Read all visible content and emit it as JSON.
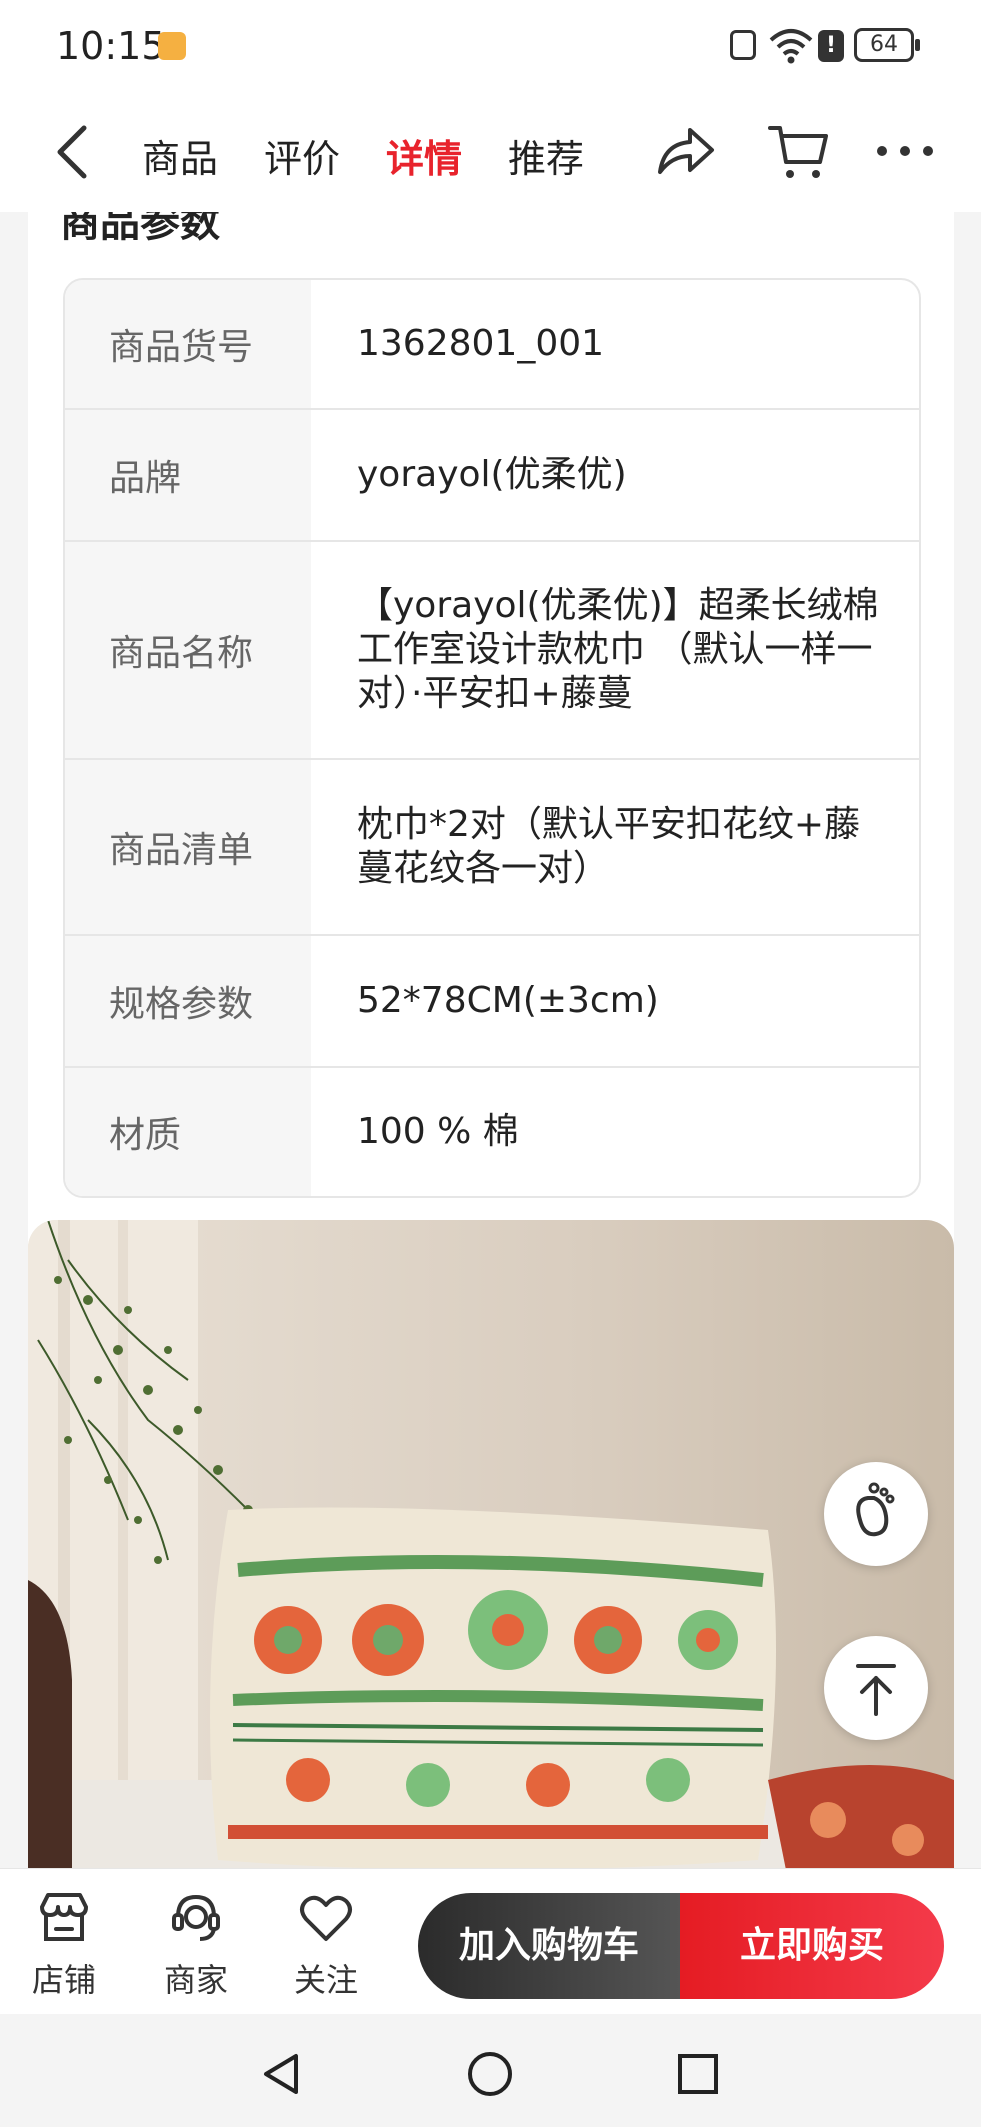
{
  "status_bar": {
    "time": "10:15",
    "battery": "64",
    "alert_glyph": "!",
    "icons": [
      "app-notification-icon",
      "nfc-icon",
      "wifi-icon",
      "alert-icon",
      "battery-icon"
    ]
  },
  "nav": {
    "tabs": [
      {
        "label": "商品",
        "active": false
      },
      {
        "label": "评价",
        "active": false
      },
      {
        "label": "详情",
        "active": true
      },
      {
        "label": "推荐",
        "active": false
      }
    ],
    "icons": [
      "back-icon",
      "share-icon",
      "cart-icon",
      "more-icon"
    ],
    "active_color": "#e8232c"
  },
  "section": {
    "title": "商品参数"
  },
  "params": [
    {
      "key": "商品货号",
      "value": "1362801_001"
    },
    {
      "key": "品牌",
      "value": "yorayol(优柔优)"
    },
    {
      "key": "商品名称",
      "value": "【yorayol(优柔优)】超柔长绒棉工作室设计款枕巾 （默认一样一对）·平安扣+藤蔓"
    },
    {
      "key": "商品清单",
      "value": "枕巾*2对（默认平安扣花纹+藤蔓花纹各一对）"
    },
    {
      "key": "规格参数",
      "value": "52*78CM(±3cm)"
    },
    {
      "key": "材质",
      "value": "100 % 棉"
    }
  ],
  "floating": [
    "footprint-icon",
    "back-to-top-icon"
  ],
  "bottom_bar": {
    "items": [
      {
        "label": "店铺",
        "icon": "store-icon"
      },
      {
        "label": "商家",
        "icon": "customer-service-icon"
      },
      {
        "label": "关注",
        "icon": "heart-icon"
      }
    ],
    "add_to_cart": "加入购物车",
    "buy_now": "立即购买",
    "buy_color": "#e51c23"
  },
  "system_nav": [
    "back-triangle-icon",
    "home-circle-icon",
    "recents-square-icon"
  ]
}
